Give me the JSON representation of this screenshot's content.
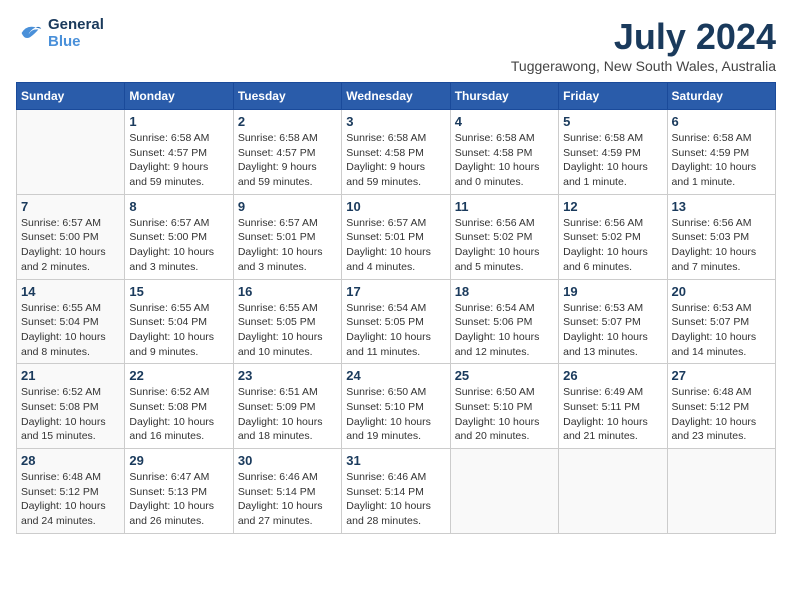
{
  "header": {
    "logo_line1": "General",
    "logo_line2": "Blue",
    "month": "July 2024",
    "location": "Tuggerawong, New South Wales, Australia"
  },
  "weekdays": [
    "Sunday",
    "Monday",
    "Tuesday",
    "Wednesday",
    "Thursday",
    "Friday",
    "Saturday"
  ],
  "weeks": [
    [
      {
        "day": "",
        "info": ""
      },
      {
        "day": "1",
        "info": "Sunrise: 6:58 AM\nSunset: 4:57 PM\nDaylight: 9 hours\nand 59 minutes."
      },
      {
        "day": "2",
        "info": "Sunrise: 6:58 AM\nSunset: 4:57 PM\nDaylight: 9 hours\nand 59 minutes."
      },
      {
        "day": "3",
        "info": "Sunrise: 6:58 AM\nSunset: 4:58 PM\nDaylight: 9 hours\nand 59 minutes."
      },
      {
        "day": "4",
        "info": "Sunrise: 6:58 AM\nSunset: 4:58 PM\nDaylight: 10 hours\nand 0 minutes."
      },
      {
        "day": "5",
        "info": "Sunrise: 6:58 AM\nSunset: 4:59 PM\nDaylight: 10 hours\nand 1 minute."
      },
      {
        "day": "6",
        "info": "Sunrise: 6:58 AM\nSunset: 4:59 PM\nDaylight: 10 hours\nand 1 minute."
      }
    ],
    [
      {
        "day": "7",
        "info": "Sunrise: 6:57 AM\nSunset: 5:00 PM\nDaylight: 10 hours\nand 2 minutes."
      },
      {
        "day": "8",
        "info": "Sunrise: 6:57 AM\nSunset: 5:00 PM\nDaylight: 10 hours\nand 3 minutes."
      },
      {
        "day": "9",
        "info": "Sunrise: 6:57 AM\nSunset: 5:01 PM\nDaylight: 10 hours\nand 3 minutes."
      },
      {
        "day": "10",
        "info": "Sunrise: 6:57 AM\nSunset: 5:01 PM\nDaylight: 10 hours\nand 4 minutes."
      },
      {
        "day": "11",
        "info": "Sunrise: 6:56 AM\nSunset: 5:02 PM\nDaylight: 10 hours\nand 5 minutes."
      },
      {
        "day": "12",
        "info": "Sunrise: 6:56 AM\nSunset: 5:02 PM\nDaylight: 10 hours\nand 6 minutes."
      },
      {
        "day": "13",
        "info": "Sunrise: 6:56 AM\nSunset: 5:03 PM\nDaylight: 10 hours\nand 7 minutes."
      }
    ],
    [
      {
        "day": "14",
        "info": "Sunrise: 6:55 AM\nSunset: 5:04 PM\nDaylight: 10 hours\nand 8 minutes."
      },
      {
        "day": "15",
        "info": "Sunrise: 6:55 AM\nSunset: 5:04 PM\nDaylight: 10 hours\nand 9 minutes."
      },
      {
        "day": "16",
        "info": "Sunrise: 6:55 AM\nSunset: 5:05 PM\nDaylight: 10 hours\nand 10 minutes."
      },
      {
        "day": "17",
        "info": "Sunrise: 6:54 AM\nSunset: 5:05 PM\nDaylight: 10 hours\nand 11 minutes."
      },
      {
        "day": "18",
        "info": "Sunrise: 6:54 AM\nSunset: 5:06 PM\nDaylight: 10 hours\nand 12 minutes."
      },
      {
        "day": "19",
        "info": "Sunrise: 6:53 AM\nSunset: 5:07 PM\nDaylight: 10 hours\nand 13 minutes."
      },
      {
        "day": "20",
        "info": "Sunrise: 6:53 AM\nSunset: 5:07 PM\nDaylight: 10 hours\nand 14 minutes."
      }
    ],
    [
      {
        "day": "21",
        "info": "Sunrise: 6:52 AM\nSunset: 5:08 PM\nDaylight: 10 hours\nand 15 minutes."
      },
      {
        "day": "22",
        "info": "Sunrise: 6:52 AM\nSunset: 5:08 PM\nDaylight: 10 hours\nand 16 minutes."
      },
      {
        "day": "23",
        "info": "Sunrise: 6:51 AM\nSunset: 5:09 PM\nDaylight: 10 hours\nand 18 minutes."
      },
      {
        "day": "24",
        "info": "Sunrise: 6:50 AM\nSunset: 5:10 PM\nDaylight: 10 hours\nand 19 minutes."
      },
      {
        "day": "25",
        "info": "Sunrise: 6:50 AM\nSunset: 5:10 PM\nDaylight: 10 hours\nand 20 minutes."
      },
      {
        "day": "26",
        "info": "Sunrise: 6:49 AM\nSunset: 5:11 PM\nDaylight: 10 hours\nand 21 minutes."
      },
      {
        "day": "27",
        "info": "Sunrise: 6:48 AM\nSunset: 5:12 PM\nDaylight: 10 hours\nand 23 minutes."
      }
    ],
    [
      {
        "day": "28",
        "info": "Sunrise: 6:48 AM\nSunset: 5:12 PM\nDaylight: 10 hours\nand 24 minutes."
      },
      {
        "day": "29",
        "info": "Sunrise: 6:47 AM\nSunset: 5:13 PM\nDaylight: 10 hours\nand 26 minutes."
      },
      {
        "day": "30",
        "info": "Sunrise: 6:46 AM\nSunset: 5:14 PM\nDaylight: 10 hours\nand 27 minutes."
      },
      {
        "day": "31",
        "info": "Sunrise: 6:46 AM\nSunset: 5:14 PM\nDaylight: 10 hours\nand 28 minutes."
      },
      {
        "day": "",
        "info": ""
      },
      {
        "day": "",
        "info": ""
      },
      {
        "day": "",
        "info": ""
      }
    ]
  ]
}
